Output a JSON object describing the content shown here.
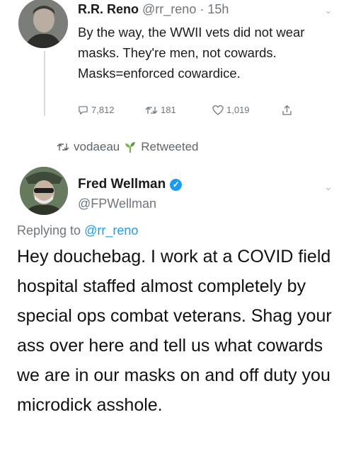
{
  "tweet1": {
    "name": "R.R. Reno",
    "handle": "@rr_reno",
    "time": "· 15h",
    "text": "By the way, the WWII vets did not wear masks. They're men, not cowards. Masks=enforced cowardice.",
    "replies": "7,812",
    "retweets": "181",
    "likes": "1,019"
  },
  "retweet_banner": {
    "user": "vodaeau",
    "label": "Retweeted"
  },
  "tweet2": {
    "name": "Fred Wellman",
    "handle": "@FPWellman",
    "replying_prefix": "Replying to ",
    "replying_handle": "@rr_reno",
    "text": "Hey douchebag. I work at a COVID field hospital staffed almost completely by special ops combat veterans. Shag your ass over here and tell us what cowards we are in our masks on and off duty you microdick asshole."
  },
  "icons": [
    "reply-icon",
    "retweet-icon",
    "like-icon",
    "share-icon",
    "chevron-down-icon",
    "verified-badge-icon",
    "sprout-emoji-icon"
  ],
  "colors": {
    "link": "#1d9bf0",
    "muted": "#6e767d",
    "verified": "#1d9bf0"
  }
}
